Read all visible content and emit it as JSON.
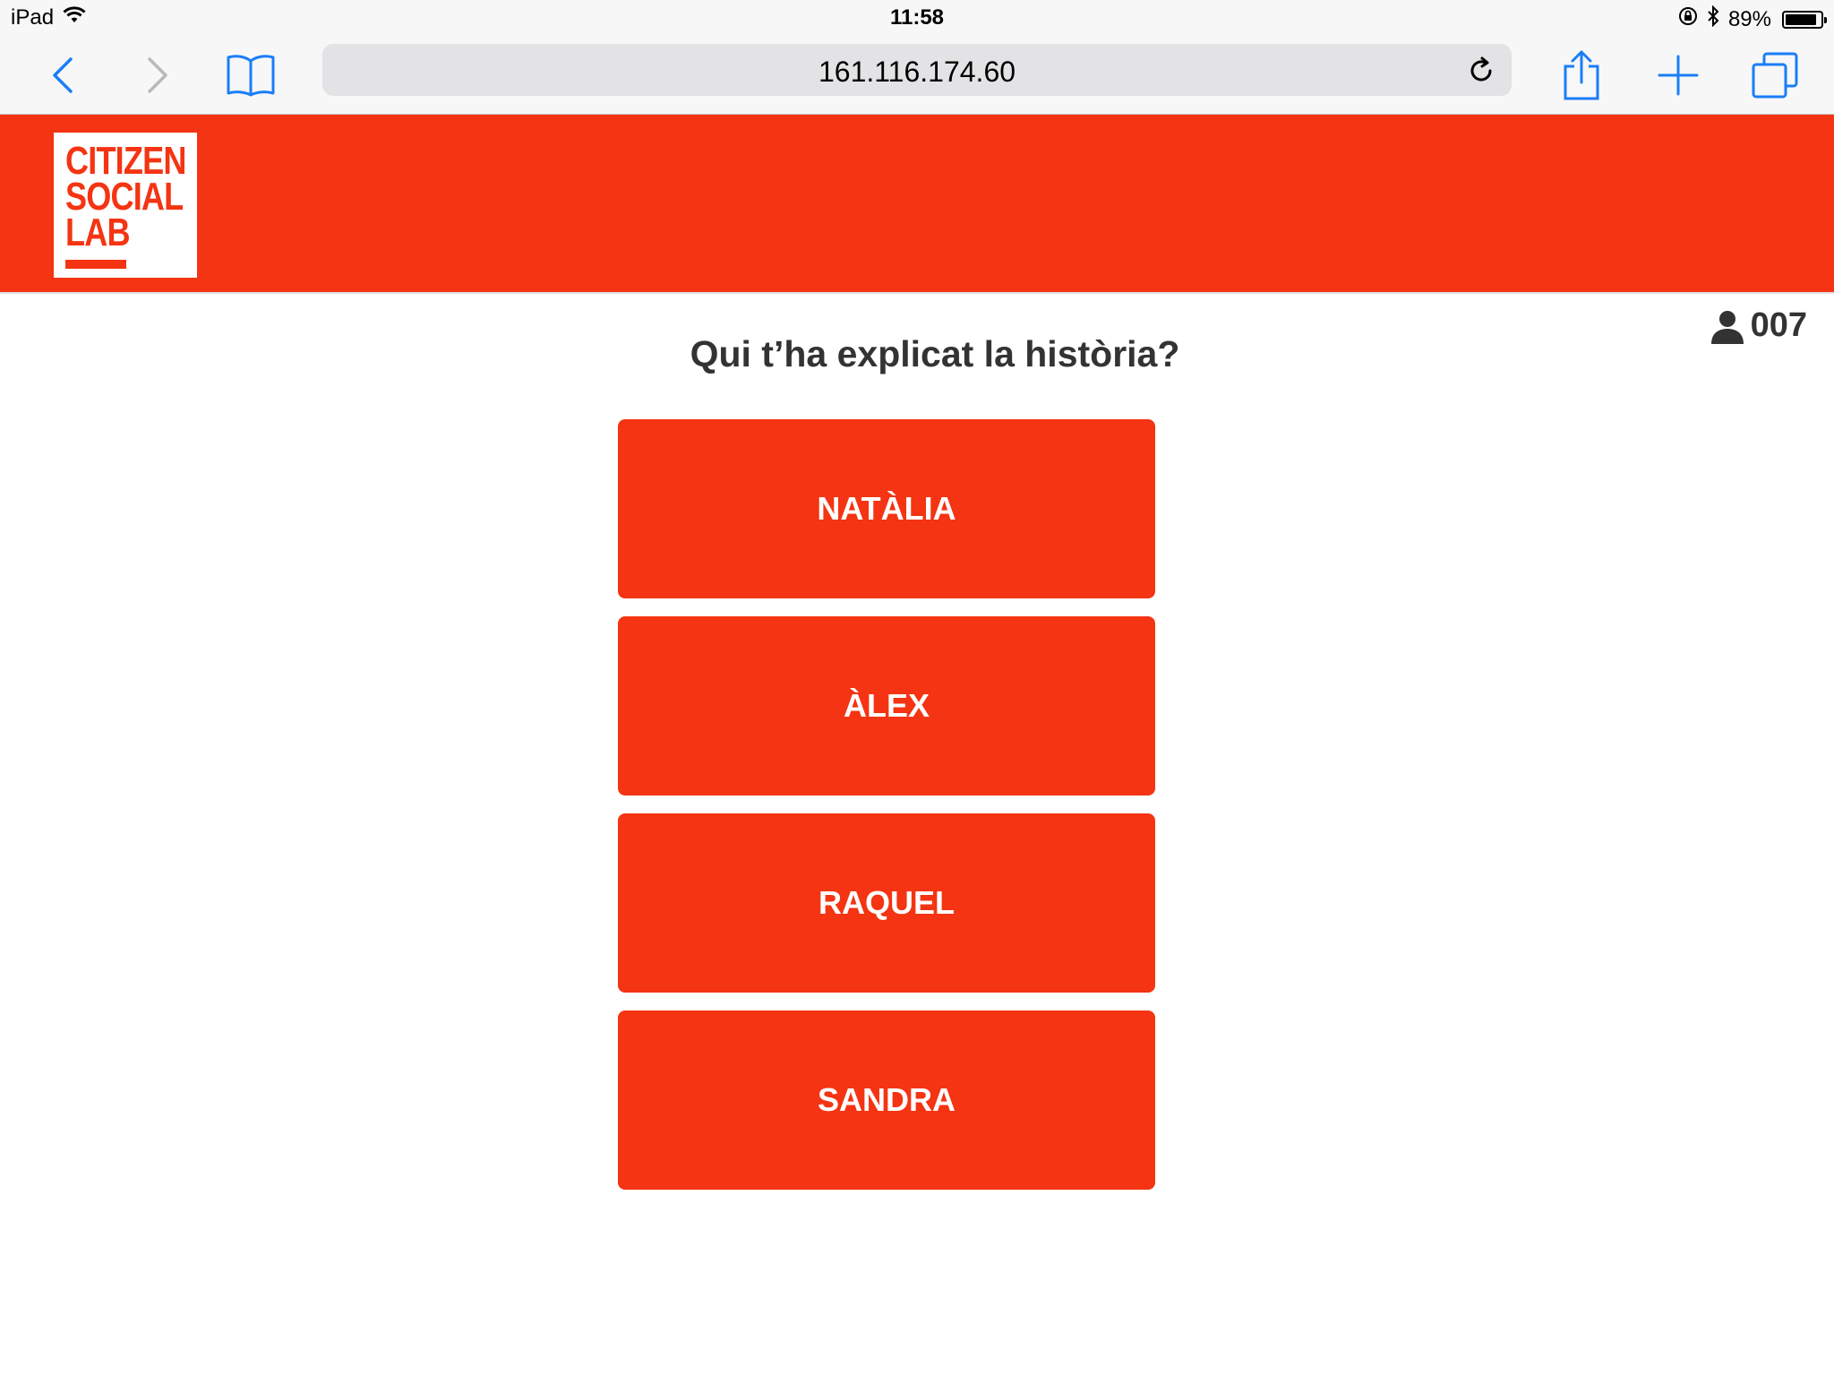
{
  "status_bar": {
    "device": "iPad",
    "time": "11:58",
    "battery_percent": "89%",
    "battery_level": 0.89,
    "icons": [
      "wifi-icon",
      "rotation-lock-icon",
      "bluetooth-icon",
      "battery-icon"
    ]
  },
  "browser": {
    "url": "161.116.174.60",
    "icons": [
      "back-icon",
      "forward-icon",
      "bookmarks-icon",
      "reload-icon",
      "share-icon",
      "new-tab-icon",
      "tabs-icon"
    ]
  },
  "header": {
    "logo_lines": [
      "CITIZEN",
      "SOCIAL",
      "LAB"
    ],
    "brand_color": "#f43412"
  },
  "user": {
    "id": "007",
    "icon": "user-icon"
  },
  "main": {
    "question": "Qui t’ha explicat la història?",
    "answers": [
      {
        "label": "NATÀLIA"
      },
      {
        "label": "ÀLEX"
      },
      {
        "label": "RAQUEL"
      },
      {
        "label": "SANDRA"
      }
    ]
  }
}
